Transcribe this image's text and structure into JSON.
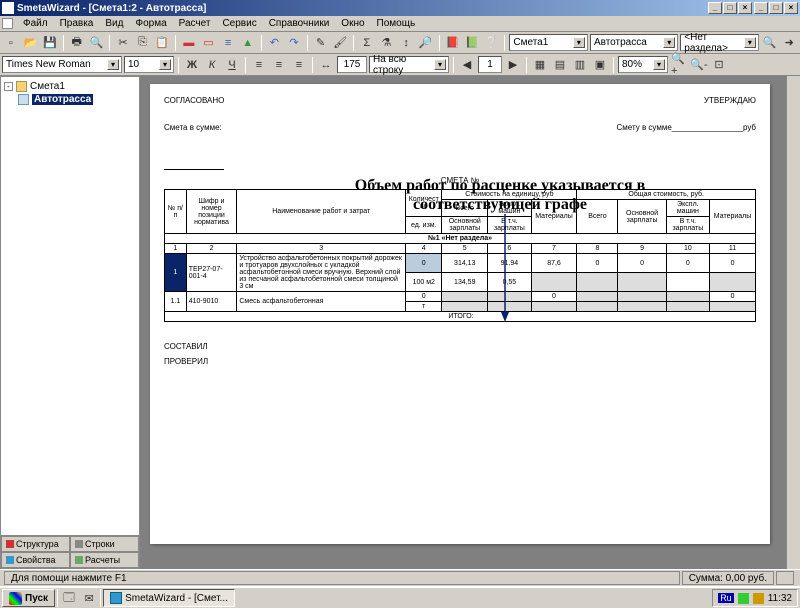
{
  "window": {
    "title": "SmetaWizard - [Смета1:2 - Автотрасса]",
    "min": "_",
    "max": "□",
    "close": "×"
  },
  "menu": {
    "items": [
      "Файл",
      "Правка",
      "Вид",
      "Форма",
      "Расчет",
      "Сервис",
      "Справочники",
      "Окно",
      "Помощь"
    ]
  },
  "toolbar1": {
    "combo1": "Смета1",
    "combo2": "Автотрасса",
    "combo3": "<Нет раздела>"
  },
  "toolbar2": {
    "font": "Times New Roman",
    "size": "10",
    "bold": "Ж",
    "italic": "К",
    "under": "Ч",
    "width_val": "175",
    "width_label": "На всю строку",
    "page": "1",
    "zoom": "80%"
  },
  "tree": {
    "root": "Смета1",
    "child": "Автотрасса"
  },
  "side_tabs": {
    "t1": "Структура",
    "t2": "Строки",
    "t3": "Свойства",
    "t4": "Расчеты"
  },
  "doc": {
    "approve_left": "СОГЛАСОВАНО",
    "approve_right": "УТВЕРЖДАЮ",
    "sum_left": "Смета в сумме:",
    "sum_right_a": "Смету в сумме",
    "sum_right_b": "руб",
    "annotation": "Объем работ по расценке указывается в соответствующей графе",
    "smeta_no": "СМЕТА №",
    "headers": {
      "npp": "№ п/п",
      "code": "Шифр и номер позиции норматива",
      "name": "Наименование работ и затрат",
      "qty": "Количество",
      "unit_cost": "Стоимость на единицу, руб",
      "total_cost": "Общая стоимость, руб.",
      "unit": "ед. изм.",
      "vsego": "Всего",
      "expl": "Экспл. машин",
      "mat": "Материалы",
      "osn_zp": "Основной зарплаты",
      "vtch_zp": "В т.ч. зарплаты"
    },
    "colnums": [
      "1",
      "2",
      "3",
      "4",
      "5",
      "6",
      "7",
      "8",
      "9",
      "10",
      "11"
    ],
    "section": "№1 «Нет раздела»",
    "rows": [
      {
        "n": "1",
        "code": "ТЕР27-07-001-4",
        "name": "Устройство асфальтобетонных покрытий дорожек и тротуаров двухслойных с укладкой асфальтобетонной смеси вручную. Верхний слой из песчаной асфальтобетонной смеси толщиной 3 см",
        "qty": "0",
        "unit": "100 м2",
        "c5": "314,13",
        "c5b": "134,59",
        "c6": "91,94",
        "c6b": "0,55",
        "c7": "87,6",
        "c8": "0",
        "c9": "0",
        "c10": "0",
        "c11": "0"
      },
      {
        "n": "1.1",
        "code": "410-9010",
        "name": "Смесь асфальтобетонная",
        "qty": "0",
        "unit": "т",
        "c5": "",
        "c5b": "",
        "c6": "",
        "c6b": "",
        "c7": "0",
        "c8": "",
        "c9": "",
        "c10": "",
        "c11": "0"
      }
    ],
    "itogo": "ИТОГО:",
    "footer1": "СОСТАВИЛ",
    "footer2": "ПРОВЕРИЛ"
  },
  "status": {
    "help": "Для помощи нажмите F1",
    "sum": "Сумма: 0,00 руб."
  },
  "taskbar": {
    "start": "Пуск",
    "task1": "SmetaWizard - [Смет...",
    "lang": "Ru",
    "time": "11:32"
  }
}
